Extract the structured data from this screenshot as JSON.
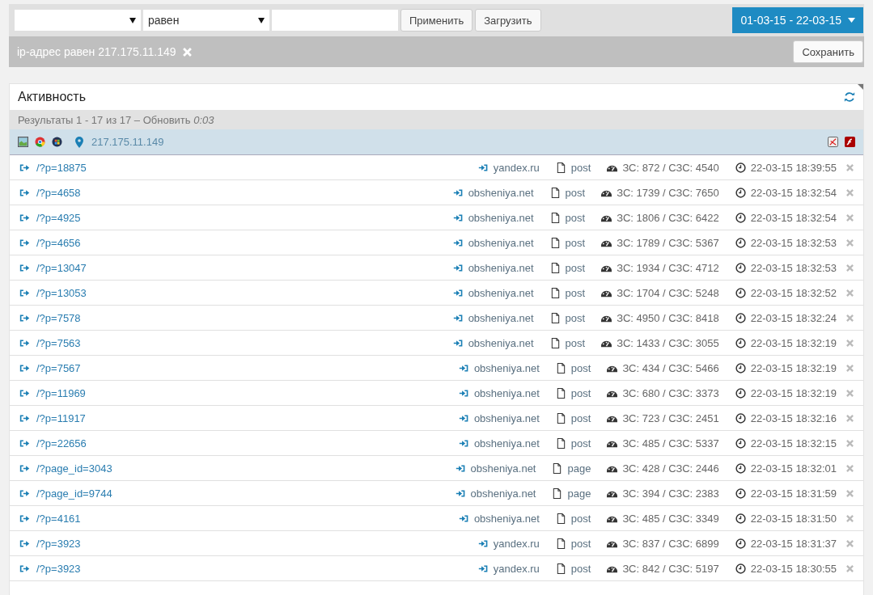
{
  "filters": {
    "operator_select": {
      "value": "равен"
    },
    "buttons": [
      "Применить",
      "Загрузить"
    ],
    "date_range": "01-03-15 - 22-03-15"
  },
  "active_filter": {
    "label": "ip-адрес равен 217.175.11.149",
    "save_button": "Сохранить"
  },
  "panel": {
    "title": "Активность",
    "results": "Результаты 1 - 17 из 17 – Обновить",
    "refresh_time": "0:03",
    "visitor": {
      "ip": "217.175.11.149"
    },
    "rows": [
      {
        "path": "/?p=18875",
        "referrer": "yandex.ru",
        "type": "post",
        "stats": "ЗС: 872 / СЗС: 4540",
        "time": "22-03-15 18:39:55"
      },
      {
        "path": "/?p=4658",
        "referrer": "obsheniya.net",
        "type": "post",
        "stats": "ЗС: 1739 / СЗС: 7650",
        "time": "22-03-15 18:32:54"
      },
      {
        "path": "/?p=4925",
        "referrer": "obsheniya.net",
        "type": "post",
        "stats": "ЗС: 1806 / СЗС: 6422",
        "time": "22-03-15 18:32:54"
      },
      {
        "path": "/?p=4656",
        "referrer": "obsheniya.net",
        "type": "post",
        "stats": "ЗС: 1789 / СЗС: 5367",
        "time": "22-03-15 18:32:53"
      },
      {
        "path": "/?p=13047",
        "referrer": "obsheniya.net",
        "type": "post",
        "stats": "ЗС: 1934 / СЗС: 4712",
        "time": "22-03-15 18:32:53"
      },
      {
        "path": "/?p=13053",
        "referrer": "obsheniya.net",
        "type": "post",
        "stats": "ЗС: 1704 / СЗС: 5248",
        "time": "22-03-15 18:32:52"
      },
      {
        "path": "/?p=7578",
        "referrer": "obsheniya.net",
        "type": "post",
        "stats": "ЗС: 4950 / СЗС: 8418",
        "time": "22-03-15 18:32:24"
      },
      {
        "path": "/?p=7563",
        "referrer": "obsheniya.net",
        "type": "post",
        "stats": "ЗС: 1433 / СЗС: 3055",
        "time": "22-03-15 18:32:19"
      },
      {
        "path": "/?p=7567",
        "referrer": "obsheniya.net",
        "type": "post",
        "stats": "ЗС: 434 / СЗС: 5466",
        "time": "22-03-15 18:32:19"
      },
      {
        "path": "/?p=11969",
        "referrer": "obsheniya.net",
        "type": "post",
        "stats": "ЗС: 680 / СЗС: 3373",
        "time": "22-03-15 18:32:19"
      },
      {
        "path": "/?p=11917",
        "referrer": "obsheniya.net",
        "type": "post",
        "stats": "ЗС: 723 / СЗС: 2451",
        "time": "22-03-15 18:32:16"
      },
      {
        "path": "/?p=22656",
        "referrer": "obsheniya.net",
        "type": "post",
        "stats": "ЗС: 485 / СЗС: 5337",
        "time": "22-03-15 18:32:15"
      },
      {
        "path": "/?page_id=3043",
        "referrer": "obsheniya.net",
        "type": "page",
        "stats": "ЗС: 428 / СЗС: 2446",
        "time": "22-03-15 18:32:01"
      },
      {
        "path": "/?page_id=9744",
        "referrer": "obsheniya.net",
        "type": "page",
        "stats": "ЗС: 394 / СЗС: 2383",
        "time": "22-03-15 18:31:59"
      },
      {
        "path": "/?p=4161",
        "referrer": "obsheniya.net",
        "type": "post",
        "stats": "ЗС: 485 / СЗС: 3349",
        "time": "22-03-15 18:31:50"
      },
      {
        "path": "/?p=3923",
        "referrer": "yandex.ru",
        "type": "post",
        "stats": "ЗС: 837 / СЗС: 6899",
        "time": "22-03-15 18:31:37"
      },
      {
        "path": "/?p=3923",
        "referrer": "yandex.ru",
        "type": "post",
        "stats": "ЗС: 842 / СЗС: 5197",
        "time": "22-03-15 18:30:55"
      }
    ]
  }
}
